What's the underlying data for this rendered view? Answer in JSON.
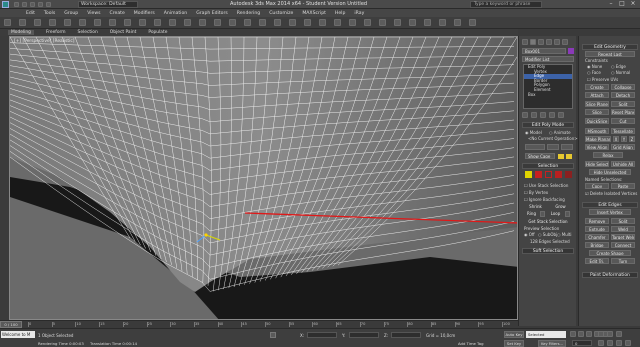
{
  "titlebar": {
    "title": "Autodesk 3ds Max 2014 x64 - Student Version   Untitled",
    "workspace": "Workspace: Default",
    "search_placeholder": "Type a keyword or phrase"
  },
  "menu": [
    "Edit",
    "Tools",
    "Group",
    "Views",
    "Create",
    "Modifiers",
    "Animation",
    "Graph Editors",
    "Rendering",
    "Customize",
    "MAXScript",
    "Help",
    "iRay"
  ],
  "ribbon": {
    "tabs": [
      "Modeling",
      "Freeform",
      "Selection",
      "Object Paint",
      "Populate"
    ],
    "active": "Modeling"
  },
  "viewport": {
    "label": "[+] [Perspective] [Realistic]"
  },
  "command_panel": {
    "object_name": "Box001",
    "modifier_list": "Modifier List",
    "stack_items": [
      "Edit Poly",
      "Vertex",
      "Edge",
      "Border",
      "Polygon",
      "Element",
      "Box"
    ],
    "selected_index": 2,
    "edit_poly_mode": "Edit Poly Mode",
    "model_label": "Model",
    "animate_label": "Animate",
    "no_current_op": "<No Current Operation>",
    "show_cage": "Show Cage",
    "selection_header": "Selection",
    "use_stack_selection": "Use Stack Selection",
    "by_vertex": "By Vertex",
    "ignore_backfacing": "Ignore Backfacing",
    "shrink": "Shrink",
    "grow": "Grow",
    "ring": "Ring",
    "loop": "Loop",
    "get_stack_selection": "Get Stack Selection",
    "preview_selection": "Preview Selection",
    "off": "Off",
    "subobj": "SubObj",
    "multi": "Multi",
    "edges_selected": "128 Edges Selected"
  },
  "right_panel": {
    "soft_selection": "Soft Selection",
    "edit_geometry": "Edit Geometry",
    "repeat_last": "Repeat Last",
    "constraints": "Constraints",
    "none": "None",
    "edge": "Edge",
    "face": "Face",
    "normal": "Normal",
    "preserve_uvs": "Preserve UVs",
    "create": "Create",
    "collapse": "Collapse",
    "attach": "Attach",
    "detach": "Detach",
    "slice_plane": "Slice Plane",
    "split": "Split",
    "slice": "Slice",
    "reset_plane": "Reset Plane",
    "quickslice": "QuickSlice",
    "cut": "Cut",
    "meshsmooth": "MSmooth",
    "tessellate": "Tessellate",
    "make_planar": "Make Planar",
    "x": "X",
    "y": "Y",
    "z": "Z",
    "view_align": "View Align",
    "grid_align": "Grid Align",
    "relax": "Relax",
    "hide_selected": "Hide Selected",
    "unhide_all": "Unhide All",
    "hide_unselected": "Hide Unselected",
    "named_selections": "Named Selections:",
    "copy": "Copy",
    "paste": "Paste",
    "delete_isolated": "Delete Isolated Vertices",
    "edit_edges": "Edit Edges",
    "insert_vertex": "Insert Vertex",
    "remove": "Remove",
    "extrude": "Extrude",
    "weld": "Weld",
    "chamfer": "Chamfer",
    "target_weld": "Target Weld",
    "bridge": "Bridge",
    "connect": "Connect",
    "create_shape": "Create Shape",
    "edit_tri": "Edit Tri.",
    "turn": "Turn",
    "paint_deformation": "Paint Deformation"
  },
  "timeline": {
    "position": "0 / 100",
    "ticks": [
      "0",
      "5",
      "10",
      "15",
      "20",
      "25",
      "30",
      "35",
      "40",
      "45",
      "50",
      "55",
      "60",
      "65",
      "70",
      "75",
      "80",
      "85",
      "90",
      "95",
      "100"
    ]
  },
  "statusbar": {
    "welcome": "Welcome to M",
    "object_selected": "1 Object Selected",
    "rendering_time": "Rendering Time 0:00:03",
    "translation_time": "Translation Time 0:00:14",
    "x_label": "X:",
    "y_label": "Y:",
    "z_label": "Z:",
    "grid": "Grid = 10,0cm",
    "add_time_tag": "Add Time Tag",
    "auto_key": "Auto Key",
    "selected": "Selected",
    "set_key": "Set Key",
    "key_filters": "Key Filters...",
    "frame": "0"
  }
}
